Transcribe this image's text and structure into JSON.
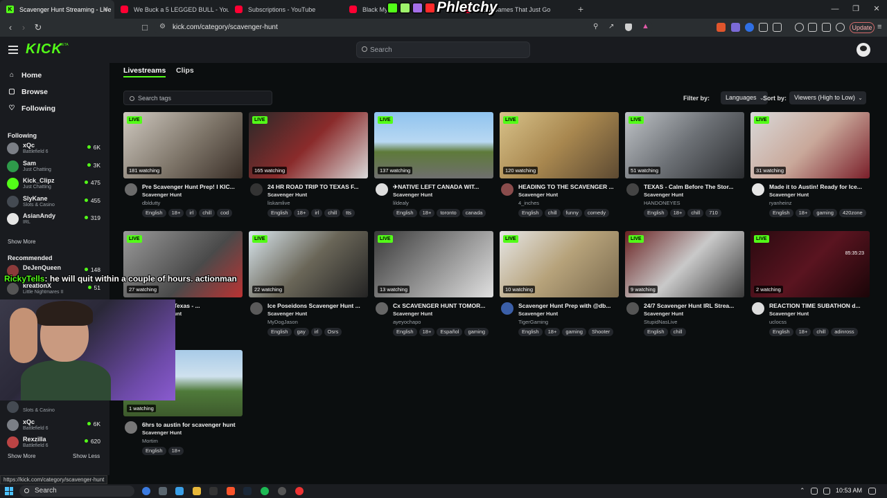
{
  "browser": {
    "tabs": [
      {
        "label": "Scavenger Hunt Streaming - Live",
        "icon": "kick-icon",
        "active": true
      },
      {
        "label": "We Buck a 5 LEGGED BULL - YouTube",
        "icon": "youtube-icon",
        "active": false
      },
      {
        "label": "Subscriptions - YouTube",
        "icon": "youtube-icon",
        "active": false
      },
      {
        "label": "Black Myth",
        "icon": "youtube-icon",
        "active": false
      },
      {
        "label": "NEW Games That Just Go",
        "icon": "youtube-icon",
        "active": false
      }
    ],
    "url": "kick.com/category/scavenger-hunt",
    "update_label": "Update",
    "status_url": "https://kick.com/category/scavenger-hunt"
  },
  "overlay": {
    "brand": "Phletchy",
    "chat_user": "RickyTells",
    "chat_text": ": he will quit within a couple of hours. actionman"
  },
  "header": {
    "logo": "KICK",
    "logo_badge": "BETA",
    "search_placeholder": "Search"
  },
  "sidebar": {
    "nav": [
      {
        "label": "Home",
        "icon": "home-icon"
      },
      {
        "label": "Browse",
        "icon": "browse-icon"
      },
      {
        "label": "Following",
        "icon": "heart-icon"
      }
    ],
    "following_title": "Following",
    "following": [
      {
        "name": "xQc",
        "category": "Battlefield 6",
        "viewers": "6K",
        "color": "#7b7f86"
      },
      {
        "name": "Sam",
        "category": "Just Chatting",
        "viewers": "3K",
        "color": "#2e9a4a"
      },
      {
        "name": "Kick_Clipz",
        "category": "Just Chatting",
        "viewers": "475",
        "color": "#53fc18"
      },
      {
        "name": "SlyKane",
        "category": "Slots & Casino",
        "viewers": "455",
        "color": "#444a52"
      },
      {
        "name": "AsianAndy",
        "category": "IRL",
        "viewers": "319",
        "color": "#e5e5e5"
      }
    ],
    "show_more": "Show More",
    "recommended_title": "Recommended",
    "recommended": [
      {
        "name": "DeJenQueen",
        "category": "",
        "viewers": "148",
        "color": "#8b3a3a"
      },
      {
        "name": "kreationX",
        "category": "Little Nightmares II",
        "viewers": "51",
        "color": "#555"
      }
    ],
    "lower": [
      {
        "name": "",
        "category": "Slots & Casino",
        "viewers": "",
        "color": "#444a52"
      },
      {
        "name": "xQc",
        "category": "Battlefield 6",
        "viewers": "6K",
        "color": "#7b7f86"
      },
      {
        "name": "Rexzilla",
        "category": "Battlefield 6",
        "viewers": "620",
        "color": "#b44"
      }
    ],
    "show_more_2": "Show More",
    "show_less": "Show Less"
  },
  "main": {
    "tabs": [
      "Livestreams",
      "Clips"
    ],
    "tag_search_placeholder": "Search tags",
    "filter_label": "Filter by:",
    "filter_value": "Languages",
    "sort_label": "Sort by:",
    "sort_value": "Viewers (High to Low)",
    "live_label": "LIVE",
    "cards": [
      {
        "title": "Pre Scavenger Hunt Prep! I KIC...",
        "category": "Scavenger Hunt",
        "user": "dbldutty",
        "watching": "181 watching",
        "tags": [
          "English",
          "18+",
          "irl",
          "chill",
          "cod"
        ],
        "thumb": "linear-gradient(135deg,#cfc9c0,#7d7468 55%,#3a2f28)",
        "avatar": "#6b6b6b"
      },
      {
        "title": "24 HR ROAD TRIP TO TEXAS F...",
        "category": "Scavenger Hunt",
        "user": "liskamlive",
        "watching": "165 watching",
        "tags": [
          "English",
          "18+",
          "irl",
          "chill",
          "tts"
        ],
        "thumb": "linear-gradient(135deg,#2a2a2a,#8a2b2b 50%,#d9d9d9)",
        "avatar": "#333"
      },
      {
        "title": "✈NATIVE LEFT CANADA WIT...",
        "category": "Scavenger Hunt",
        "user": "lildealy",
        "watching": "137 watching",
        "tags": [
          "English",
          "18+",
          "toronto",
          "canada"
        ],
        "thumb": "linear-gradient(180deg,#8fc3ef,#b8d8f2 45%,#5e7a3a 60%,#6f6f6f)",
        "avatar": "#ddd"
      },
      {
        "title": "HEADING TO THE SCAVENGER ...",
        "category": "Scavenger Hunt",
        "user": "4_inches",
        "watching": "120 watching",
        "tags": [
          "English",
          "chill",
          "funny",
          "comedy"
        ],
        "thumb": "linear-gradient(135deg,#d8c28a,#a8874f 50%,#5d4a32)",
        "avatar": "#8a4c4c"
      },
      {
        "title": "TEXAS - Calm Before The Stor...",
        "category": "Scavenger Hunt",
        "user": "HANDONEYES",
        "watching": "51 watching",
        "tags": [
          "English",
          "18+",
          "chill",
          "710"
        ],
        "thumb": "linear-gradient(135deg,#bfc3c7,#6c7075 50%,#2b2d30)",
        "avatar": "#444"
      },
      {
        "title": "Made it to Austin! Ready for Ice...",
        "category": "Scavenger Hunt",
        "user": "ryanheinz",
        "watching": "31 watching",
        "tags": [
          "English",
          "18+",
          "gaming",
          "420zone"
        ],
        "thumb": "linear-gradient(135deg,#d9d9d9,#c9a89a 50%,#7a1f2a)",
        "avatar": "#e6e6e6"
      },
      {
        "title": "M - Austin, Texas - ...",
        "category": "Scavenger Hunt",
        "user": "",
        "watching": "27 watching",
        "tags": [],
        "thumb": "linear-gradient(135deg,#9a9a9a,#4a4a4a 60%,#b33)",
        "avatar": "#555"
      },
      {
        "title": "Ice Poseidons Scavenger Hunt ...",
        "category": "Scavenger Hunt",
        "user": "MyDogJason",
        "watching": "22 watching",
        "tags": [
          "English",
          "gay",
          "irl",
          "Osrs"
        ],
        "thumb": "linear-gradient(135deg,#d9e6ee,#6a6658 50%,#242424)",
        "avatar": "#5a5a5a"
      },
      {
        "title": "Cx SCAVENGER HUNT TOMOR...",
        "category": "Scavenger Hunt",
        "user": "ayeyochapo",
        "watching": "13 watching",
        "tags": [
          "English",
          "18+",
          "Español",
          "gaming"
        ],
        "thumb": "linear-gradient(135deg,#3a3a3a,#8d8d8d 50%,#e0e0e0)",
        "avatar": "#666"
      },
      {
        "title": "Scavenger Hunt Prep with @db...",
        "category": "Scavenger Hunt",
        "user": "TigerGaming",
        "watching": "10 watching",
        "tags": [
          "English",
          "18+",
          "gaming",
          "Shooter"
        ],
        "thumb": "linear-gradient(135deg,#e6e6e6,#b6a27a 50%,#7a6a4e)",
        "avatar": "#3b5fa8"
      },
      {
        "title": "24/7 Scavenger Hunt IRL Strea...",
        "category": "Scavenger Hunt",
        "user": "StupidNasLive",
        "watching": "9 watching",
        "tags": [
          "English",
          "chill"
        ],
        "thumb": "linear-gradient(135deg,#6a2222,#c9c9c9 50%,#3a3a3a)",
        "avatar": "#555"
      },
      {
        "title": "REACTION TIME SUBATHON d...",
        "category": "Scavenger Hunt",
        "user": "uclocss",
        "watching": "2 watching",
        "tags": [
          "English",
          "18+",
          "chill",
          "adinross"
        ],
        "thumb": "linear-gradient(135deg,#2a0a10,#5a1420 50%,#1a0508)",
        "avatar": "#ddd"
      },
      {
        "title": "6hrs to austin for scavenger hunt",
        "category": "Scavenger Hunt",
        "user": "Mortim",
        "watching": "1 watching",
        "tags": [
          "English",
          "18+"
        ],
        "thumb": "linear-gradient(180deg,#a8cbe8,#cfe1ee 40%,#4f7a3a 62%,#3d5a2c)",
        "avatar": "#777"
      }
    ],
    "card12_timestamp": "85:35:23"
  },
  "taskbar": {
    "search_label": "Search",
    "time": "10:53 AM"
  }
}
